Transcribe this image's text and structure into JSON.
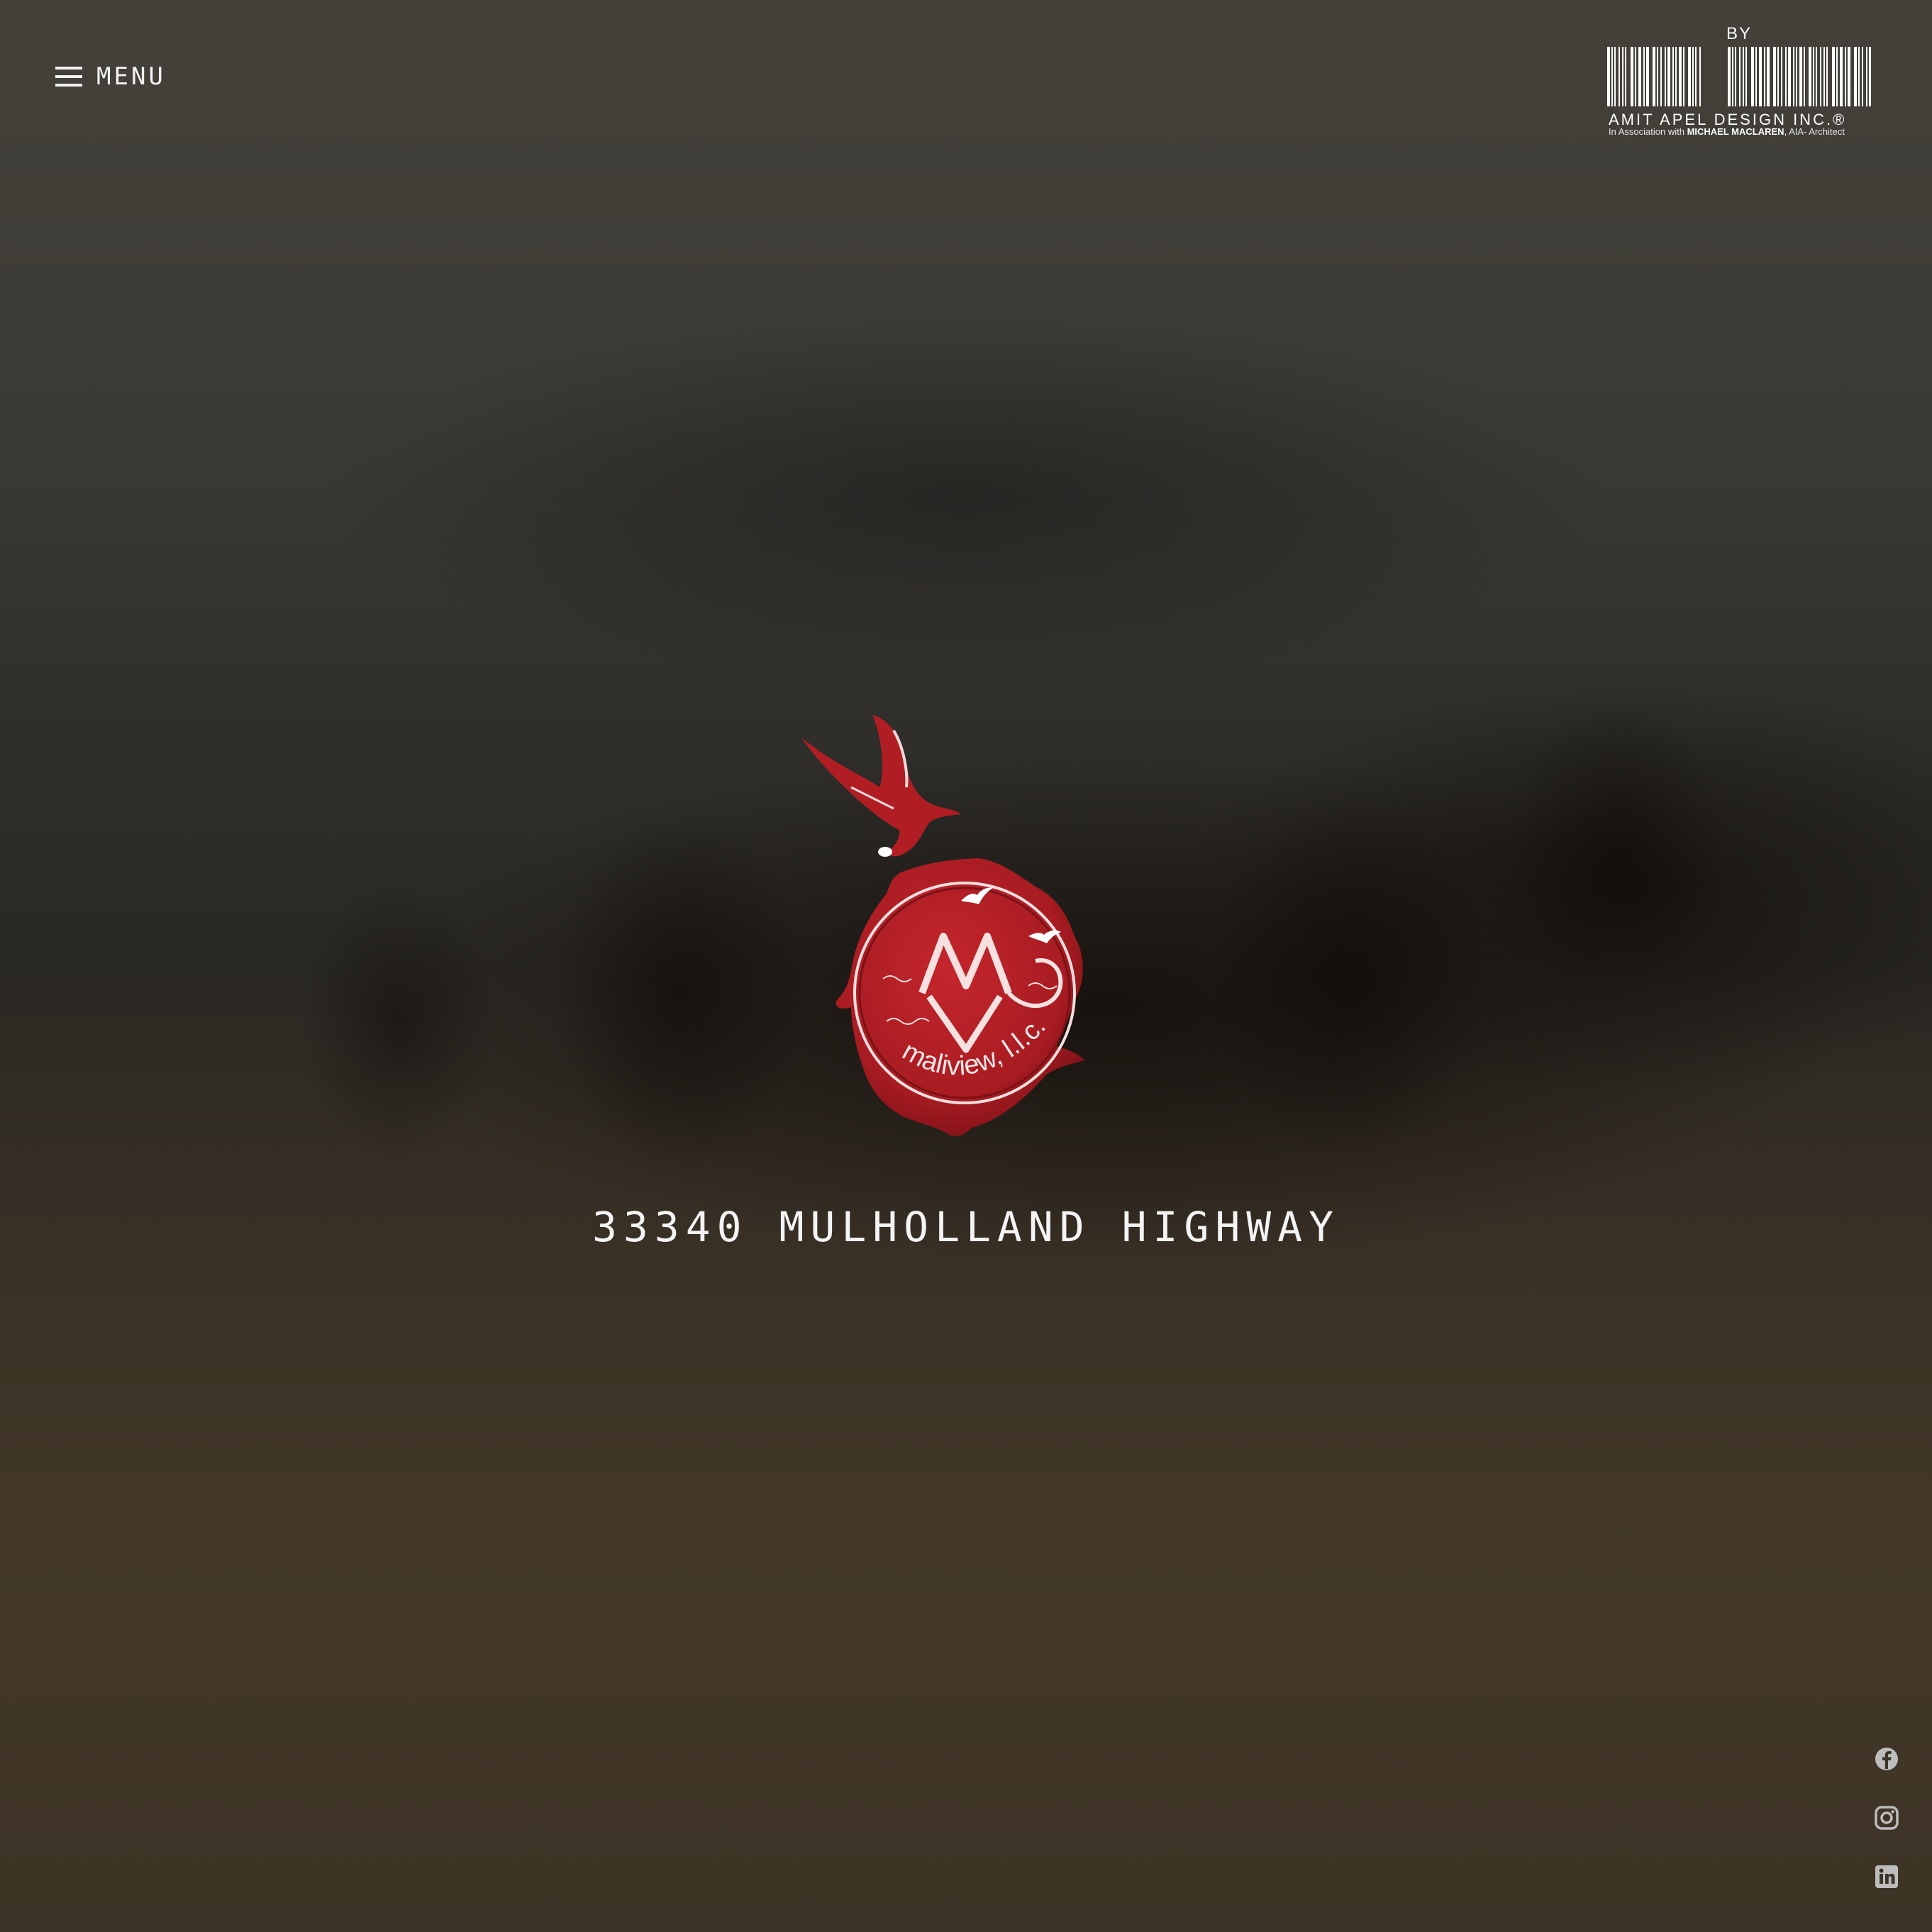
{
  "header": {
    "menu_label": "MENU"
  },
  "brand": {
    "by_label": "BY",
    "company_name": "AMIT APEL DESIGN INC.®",
    "association_prefix": "In Association with",
    "association_name": "MICHAEL MACLAREN",
    "association_suffix": ", AIA- Architect"
  },
  "logo": {
    "seal_text": "maliview, l.l.c.",
    "monogram": "MV",
    "seal_color": "#b01e24"
  },
  "main": {
    "address": "33340 MULHOLLAND HIGHWAY"
  },
  "social": [
    {
      "icon": "facebook-icon"
    },
    {
      "icon": "instagram-icon"
    },
    {
      "icon": "linkedin-icon"
    }
  ],
  "colors": {
    "text": "#f2f2f2",
    "icon": "#bdbdbd",
    "accent": "#b01e24"
  }
}
